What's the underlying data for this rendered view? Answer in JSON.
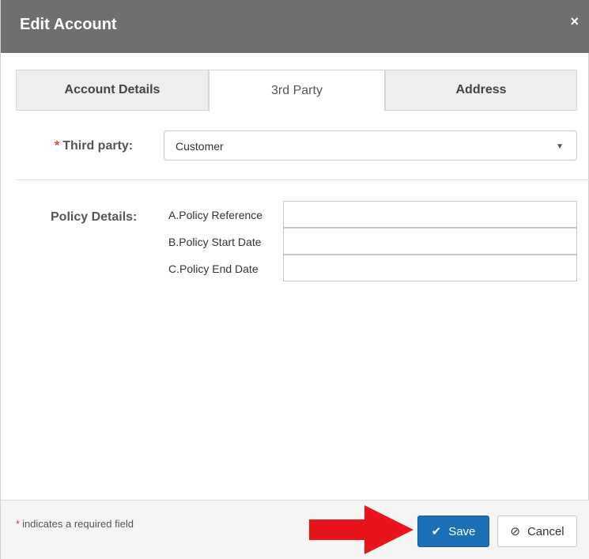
{
  "dialog": {
    "title": "Edit Account",
    "close_icon": "×"
  },
  "tabs": [
    {
      "label": "Account Details",
      "active": false
    },
    {
      "label": "3rd Party",
      "active": true
    },
    {
      "label": "Address",
      "active": false
    }
  ],
  "third_party": {
    "required_marker": "*",
    "label": "Third party:",
    "selected_value": "Customer",
    "arrow_icon": "▼"
  },
  "policy": {
    "label": "Policy Details:",
    "fields": [
      {
        "label": "A.Policy Reference",
        "value": ""
      },
      {
        "label": "B.Policy Start Date",
        "value": ""
      },
      {
        "label": "C.Policy End Date",
        "value": ""
      }
    ]
  },
  "footer": {
    "required_marker": "*",
    "required_note": "indicates a required field",
    "save_label": "Save",
    "save_icon": "✔",
    "cancel_label": "Cancel",
    "cancel_icon": "⊘"
  },
  "colors": {
    "titlebar": "#6f6f6f",
    "primary": "#1a6fb5",
    "required": "#e0403d",
    "arrow": "#e8141c"
  }
}
